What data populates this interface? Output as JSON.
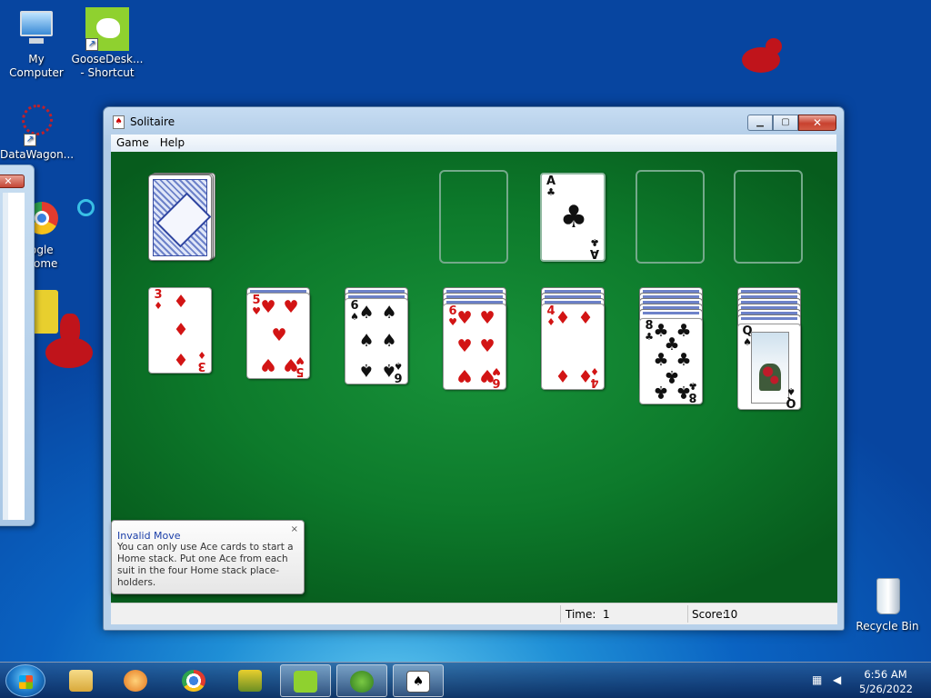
{
  "desktop": {
    "icons": [
      {
        "label": "My Computer"
      },
      {
        "label": "GooseDesk... - Shortcut"
      },
      {
        "label": "DataWagon..."
      },
      {
        "label": "ogle"
      },
      {
        "label": "ome"
      },
      {
        "label": "Recycle Bin"
      }
    ],
    "side_window_close": "✕"
  },
  "window": {
    "title": "Solitaire",
    "menu": [
      "Game",
      "Help"
    ],
    "controls": {
      "min": "▁",
      "max": "▢",
      "close": "✕"
    }
  },
  "game": {
    "foundation": {
      "occupied_rank": "A",
      "occupied_suit": "♣"
    },
    "tableau": [
      {
        "rank": "3",
        "suit": "♦",
        "color": "red"
      },
      {
        "rank": "5",
        "suit": "♥",
        "color": "red"
      },
      {
        "rank": "6",
        "suit": "♠",
        "color": "black"
      },
      {
        "rank": "6",
        "suit": "♥",
        "color": "red"
      },
      {
        "rank": "4",
        "suit": "♦",
        "color": "red"
      },
      {
        "rank": "8",
        "suit": "♣",
        "color": "black"
      },
      {
        "rank": "Q",
        "suit": "♠",
        "color": "black"
      }
    ]
  },
  "tooltip": {
    "title": "Invalid Move",
    "text": "You can only use Ace cards to start a Home stack. Put one Ace from each suit in the four Home stack place-holders.",
    "close": "×"
  },
  "status": {
    "time_label": "Time:",
    "time_value": "1",
    "score_label": "Score:",
    "score_value": "10"
  },
  "taskbar": {
    "time": "6:56 AM",
    "date": "5/26/2022"
  }
}
